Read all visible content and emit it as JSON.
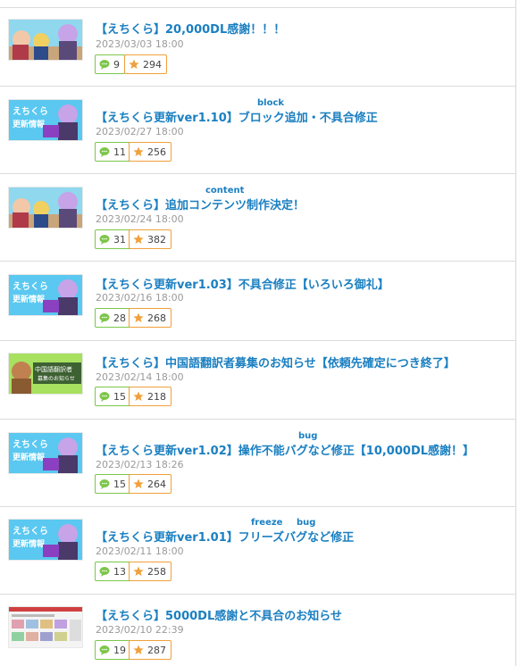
{
  "colors": {
    "title": "#1a7fc1",
    "comment_border": "#7cc64a",
    "star_border": "#f0a03c",
    "date": "#9a9a9a"
  },
  "icons": {
    "comment": "speech-bubble-icon",
    "star": "star-icon"
  },
  "posts": [
    {
      "title": "【えちくら】20,000DL感謝！！！",
      "date": "2023/03/03 18:00",
      "comments": "9",
      "stars": "294",
      "rubies": []
    },
    {
      "title": "【えちくら更新ver1.10】ブロック追加・不具合修正",
      "date": "2023/02/27 18:00",
      "comments": "11",
      "stars": "256",
      "rubies": [
        "block"
      ]
    },
    {
      "title": "【えちくら】追加コンテンツ制作決定！",
      "date": "2023/02/24 18:00",
      "comments": "31",
      "stars": "382",
      "rubies": [
        "content"
      ]
    },
    {
      "title": "【えちくら更新ver1.03】不具合修正【いろいろ御礼】",
      "date": "2023/02/16 18:00",
      "comments": "28",
      "stars": "268",
      "rubies": []
    },
    {
      "title": "【えちくら】中国語翻訳者募集のお知らせ【依頼先確定につき終了】",
      "date": "2023/02/14 18:00",
      "comments": "15",
      "stars": "218",
      "rubies": []
    },
    {
      "title": "【えちくら更新ver1.02】操作不能バグなど修正【10,000DL感謝！】",
      "date": "2023/02/13 18:26",
      "comments": "15",
      "stars": "264",
      "rubies": [
        "bug"
      ]
    },
    {
      "title": "【えちくら更新ver1.01】フリーズバグなど修正",
      "date": "2023/02/11 18:00",
      "comments": "13",
      "stars": "258",
      "rubies": [
        "freeze",
        "bug"
      ]
    },
    {
      "title": "【えちくら】5000DL感謝と不具合のお知らせ",
      "date": "2023/02/10 22:39",
      "comments": "19",
      "stars": "287",
      "rubies": []
    }
  ]
}
